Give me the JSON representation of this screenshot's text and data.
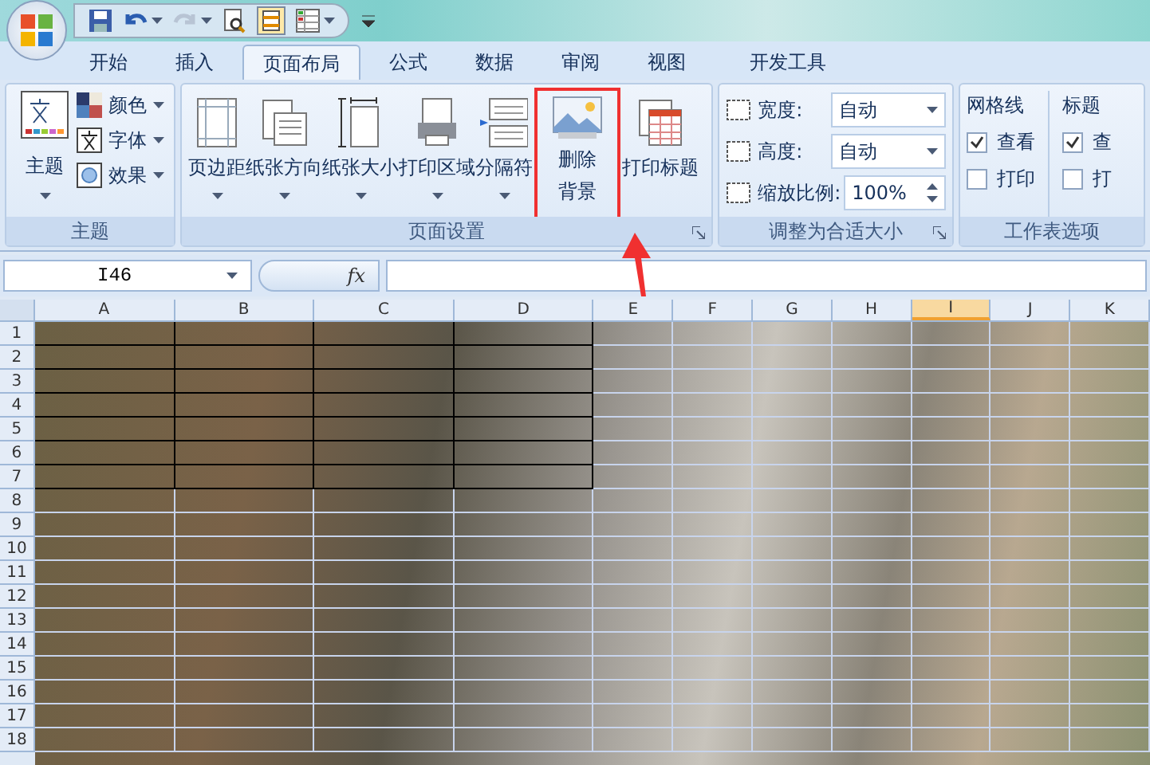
{
  "quick_access": {
    "items": [
      {
        "kind": "save"
      },
      {
        "kind": "undo"
      },
      {
        "kind": "redo",
        "disabled": true
      },
      {
        "kind": "preview"
      },
      {
        "kind": "layout"
      },
      {
        "kind": "table"
      }
    ]
  },
  "tabs": [
    {
      "label": "开始",
      "selected": false
    },
    {
      "label": "插入",
      "selected": false
    },
    {
      "label": "页面布局",
      "selected": true
    },
    {
      "label": "公式",
      "selected": false
    },
    {
      "label": "数据",
      "selected": false
    },
    {
      "label": "审阅",
      "selected": false
    },
    {
      "label": "视图",
      "selected": false
    },
    {
      "label": "开发工具",
      "selected": false
    }
  ],
  "theme_group": {
    "label": "主题",
    "big_button": "主题",
    "small_buttons": [
      {
        "label": "颜色",
        "kind": "colors"
      },
      {
        "label": "字体",
        "kind": "fonts"
      },
      {
        "label": "效果",
        "kind": "effects"
      }
    ]
  },
  "page_setup_group": {
    "label": "页面设置",
    "buttons": [
      {
        "label": "页边距",
        "kind": "margins",
        "dropdown": true
      },
      {
        "label": "纸张方向",
        "kind": "orientation",
        "dropdown": true
      },
      {
        "label": "纸张大小",
        "kind": "size",
        "dropdown": true
      },
      {
        "label": "打印区域",
        "kind": "print_area",
        "dropdown": true
      },
      {
        "label": "分隔符",
        "kind": "breaks",
        "dropdown": true
      },
      {
        "label": [
          "删除",
          "背景"
        ],
        "kind": "background",
        "dropdown": false,
        "highlighted": true
      },
      {
        "label": "打印标题",
        "kind": "titles",
        "dropdown": false
      }
    ]
  },
  "scale_group": {
    "label": "调整为合适大小",
    "fields": [
      {
        "label": "宽度:",
        "value": "自动",
        "kind": "dropdown"
      },
      {
        "label": "高度:",
        "value": "自动",
        "kind": "dropdown"
      },
      {
        "label": "缩放比例:",
        "value": "100%",
        "kind": "spinner"
      }
    ]
  },
  "sheet_options_group": {
    "label": "工作表选项",
    "columns": [
      {
        "heading": "网格线",
        "options": [
          {
            "label": "查看",
            "checked": true
          },
          {
            "label": "打印",
            "checked": false
          }
        ]
      },
      {
        "heading": "标题",
        "options": [
          {
            "label": "查",
            "checked": true
          },
          {
            "label": "打",
            "checked": false
          }
        ]
      }
    ]
  },
  "formula_bar": {
    "name_box": "I46",
    "fx": "fx"
  },
  "sheet": {
    "columns": [
      {
        "label": "A",
        "selected": false,
        "bordered": true
      },
      {
        "label": "B",
        "selected": false,
        "bordered": true
      },
      {
        "label": "C",
        "selected": false,
        "bordered": true
      },
      {
        "label": "D",
        "selected": false,
        "bordered": true
      },
      {
        "label": "E",
        "selected": false,
        "bordered": false
      },
      {
        "label": "F",
        "selected": false,
        "bordered": false
      },
      {
        "label": "G",
        "selected": false,
        "bordered": false
      },
      {
        "label": "H",
        "selected": false,
        "bordered": false
      },
      {
        "label": "I",
        "selected": true,
        "bordered": false
      },
      {
        "label": "J",
        "selected": false,
        "bordered": false
      },
      {
        "label": "K",
        "selected": false,
        "bordered": false
      }
    ],
    "rows": [
      {
        "label": "1",
        "bordered": true
      },
      {
        "label": "2",
        "bordered": true
      },
      {
        "label": "3",
        "bordered": true
      },
      {
        "label": "4",
        "bordered": true
      },
      {
        "label": "5",
        "bordered": true
      },
      {
        "label": "6",
        "bordered": true
      },
      {
        "label": "7",
        "bordered": true
      },
      {
        "label": "8",
        "bordered": false
      },
      {
        "label": "9",
        "bordered": false
      },
      {
        "label": "10",
        "bordered": false
      },
      {
        "label": "11",
        "bordered": false
      },
      {
        "label": "12",
        "bordered": false
      },
      {
        "label": "13",
        "bordered": false
      },
      {
        "label": "14",
        "bordered": false
      },
      {
        "label": "15",
        "bordered": false
      },
      {
        "label": "16",
        "bordered": false
      },
      {
        "label": "17",
        "bordered": false
      },
      {
        "label": "18",
        "bordered": false
      }
    ]
  }
}
